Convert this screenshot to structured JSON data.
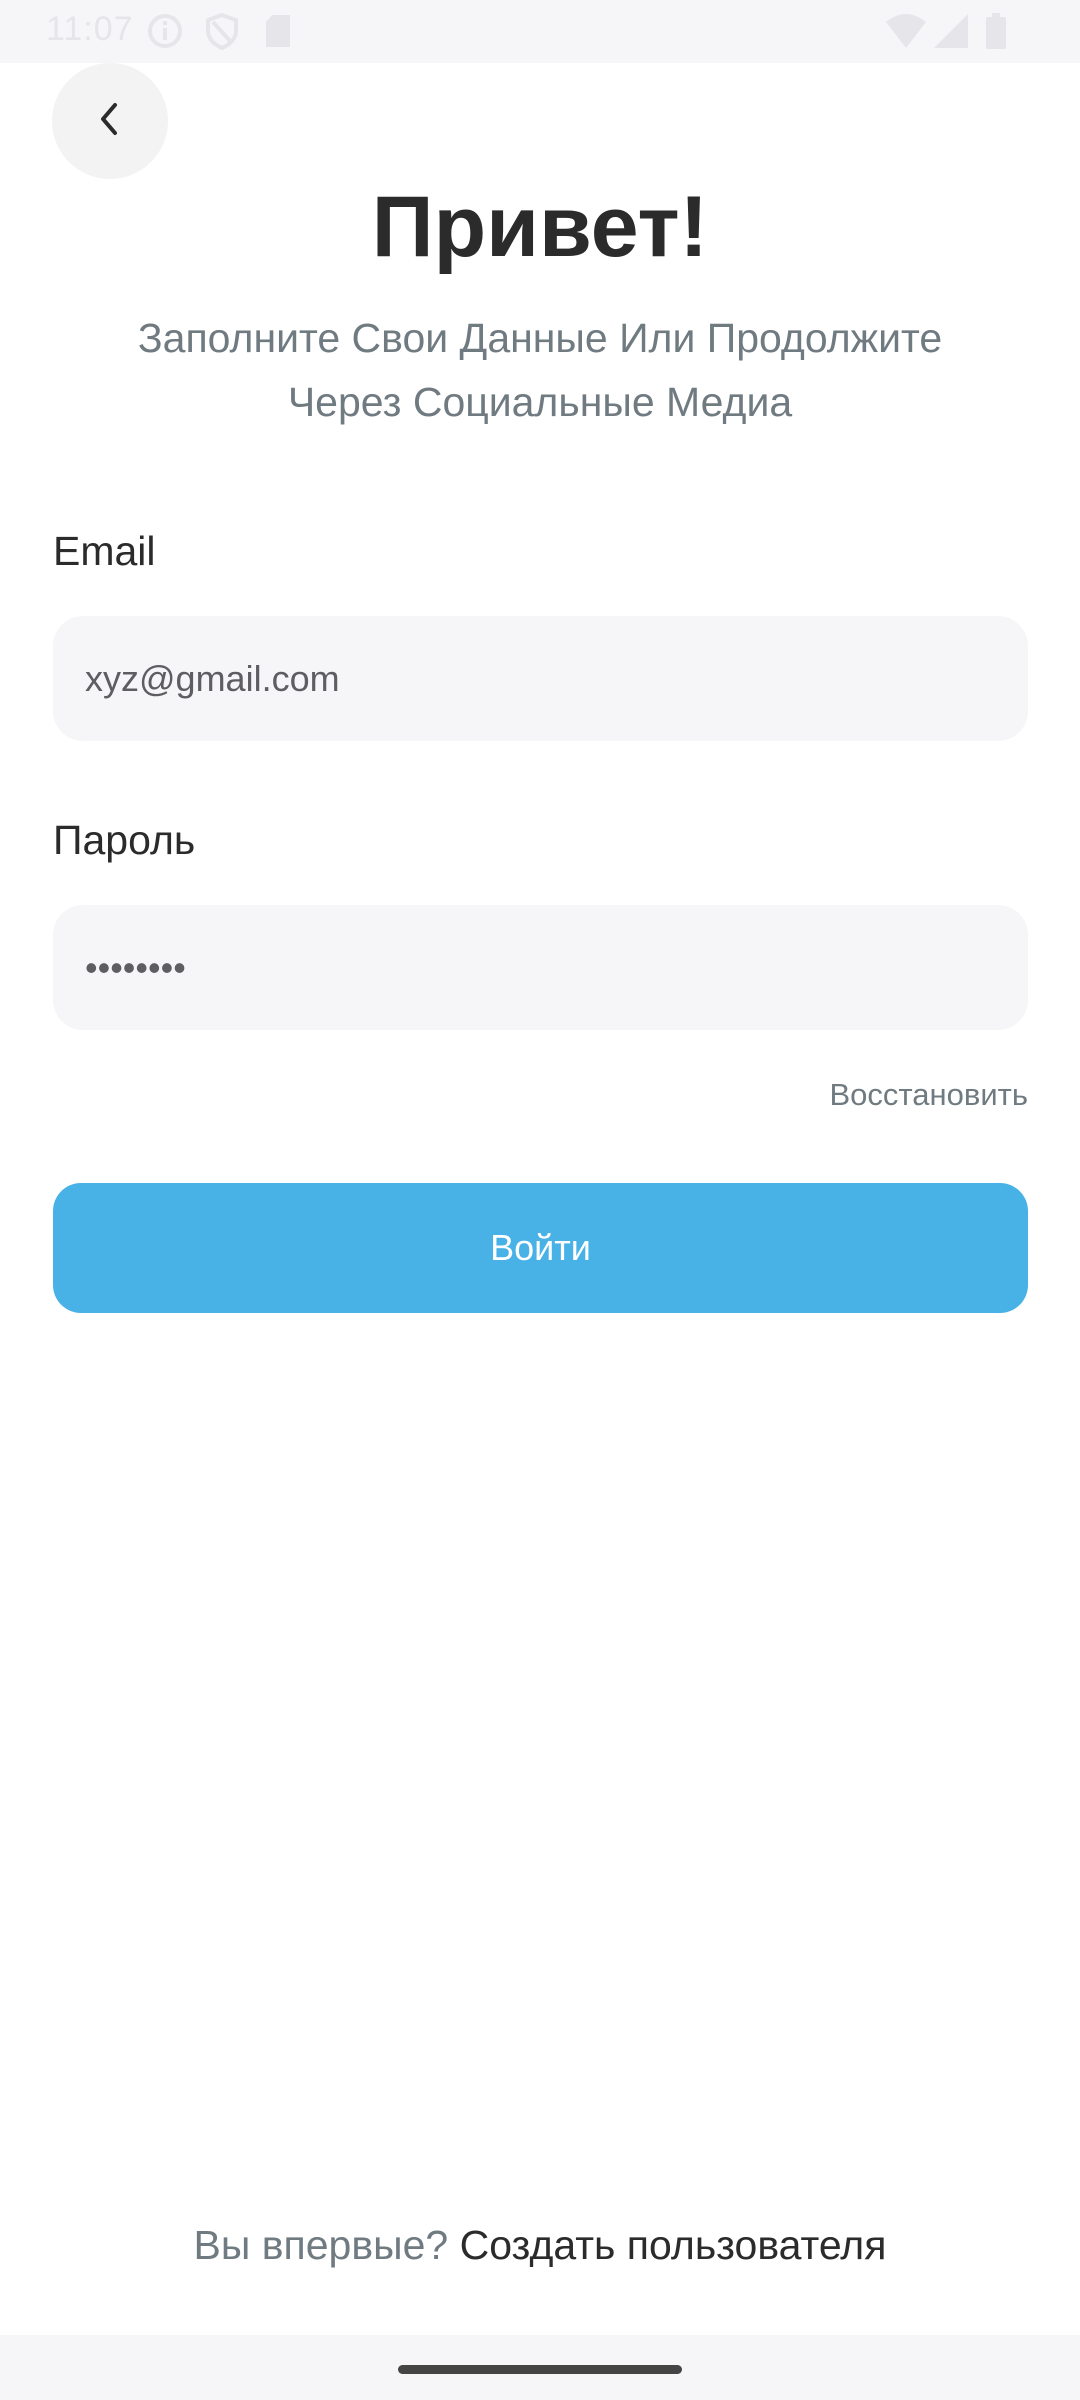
{
  "status_bar": {
    "time": "11:07",
    "icons_left": [
      "info-icon",
      "shield-icon",
      "sd-card-icon"
    ],
    "icons_right": [
      "wifi-icon",
      "signal-icon",
      "battery-icon"
    ]
  },
  "header": {
    "back_icon": "chevron-left-icon",
    "title": "Привет!",
    "subtitle_line1": "Заполните Свои Данные Или Продолжите",
    "subtitle_line2": "Через Социальные Медиа"
  },
  "form": {
    "email_label": "Email",
    "email_value": "xyz@gmail.com",
    "password_label": "Пароль",
    "password_value": "••••••••",
    "recover_label": "Восстановить",
    "login_label": "Войти"
  },
  "footer": {
    "question": "Вы впервые?",
    "create_label": "Создать пользователя"
  },
  "colors": {
    "accent": "#48B2E7",
    "text_dark": "#2B2B2B",
    "text_muted": "#707B81",
    "field_bg": "#F6F6F8"
  }
}
